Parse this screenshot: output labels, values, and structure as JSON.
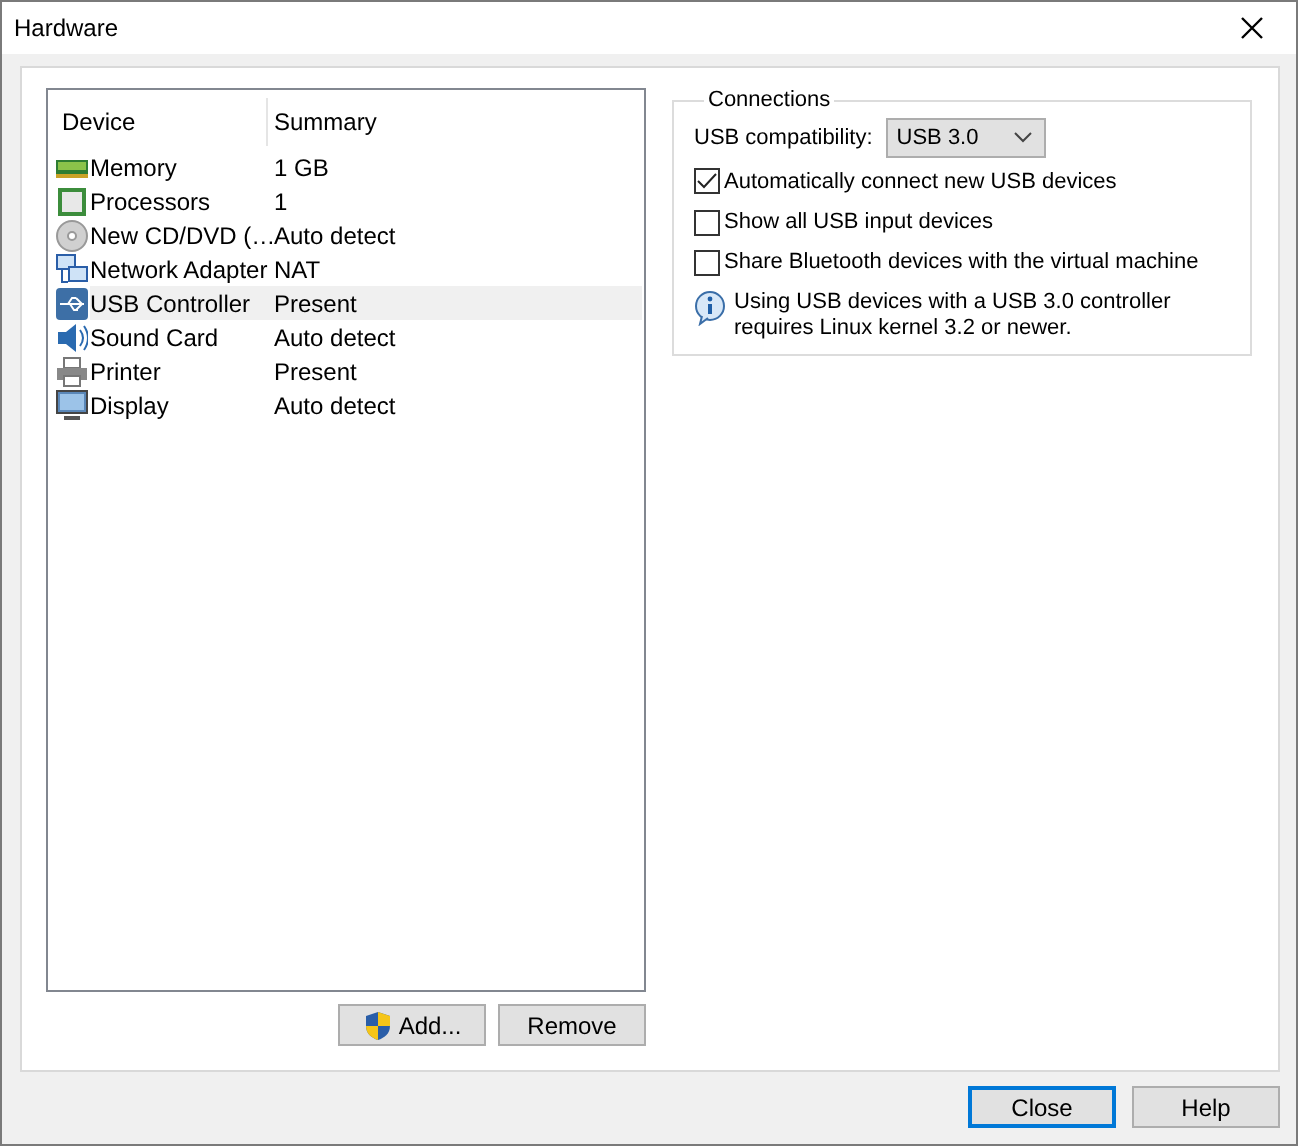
{
  "window": {
    "title": "Hardware"
  },
  "device_list": {
    "columns": [
      "Device",
      "Summary"
    ],
    "rows": [
      {
        "kind": "memory",
        "device": "Memory",
        "summary": "1 GB",
        "selected": false
      },
      {
        "kind": "processor",
        "device": "Processors",
        "summary": "1",
        "selected": false
      },
      {
        "kind": "disc",
        "device": "New CD/DVD (…",
        "summary": "Auto detect",
        "selected": false
      },
      {
        "kind": "network",
        "device": "Network Adapter",
        "summary": "NAT",
        "selected": false
      },
      {
        "kind": "usb",
        "device": "USB Controller",
        "summary": "Present",
        "selected": true
      },
      {
        "kind": "sound",
        "device": "Sound Card",
        "summary": "Auto detect",
        "selected": false
      },
      {
        "kind": "printer",
        "device": "Printer",
        "summary": "Present",
        "selected": false
      },
      {
        "kind": "display",
        "device": "Display",
        "summary": "Auto detect",
        "selected": false
      }
    ]
  },
  "list_buttons": [
    {
      "label": "Add...",
      "kind": "shield"
    },
    {
      "label": "Remove",
      "kind": "plain"
    }
  ],
  "connections": {
    "title": "Connections",
    "compatibility_label": "USB compatibility:",
    "compatibility_value": "USB 3.0",
    "options": [
      {
        "label": "Automatically connect new USB devices",
        "checked": true
      },
      {
        "label": "Show all USB input devices",
        "checked": false
      },
      {
        "label": "Share Bluetooth devices with the virtual machine",
        "checked": false
      }
    ],
    "info": "Using USB devices with a USB 3.0 controller requires Linux kernel 3.2 or newer."
  },
  "dialog_buttons": [
    {
      "label": "Close",
      "default": true
    },
    {
      "label": "Help",
      "default": false
    }
  ]
}
